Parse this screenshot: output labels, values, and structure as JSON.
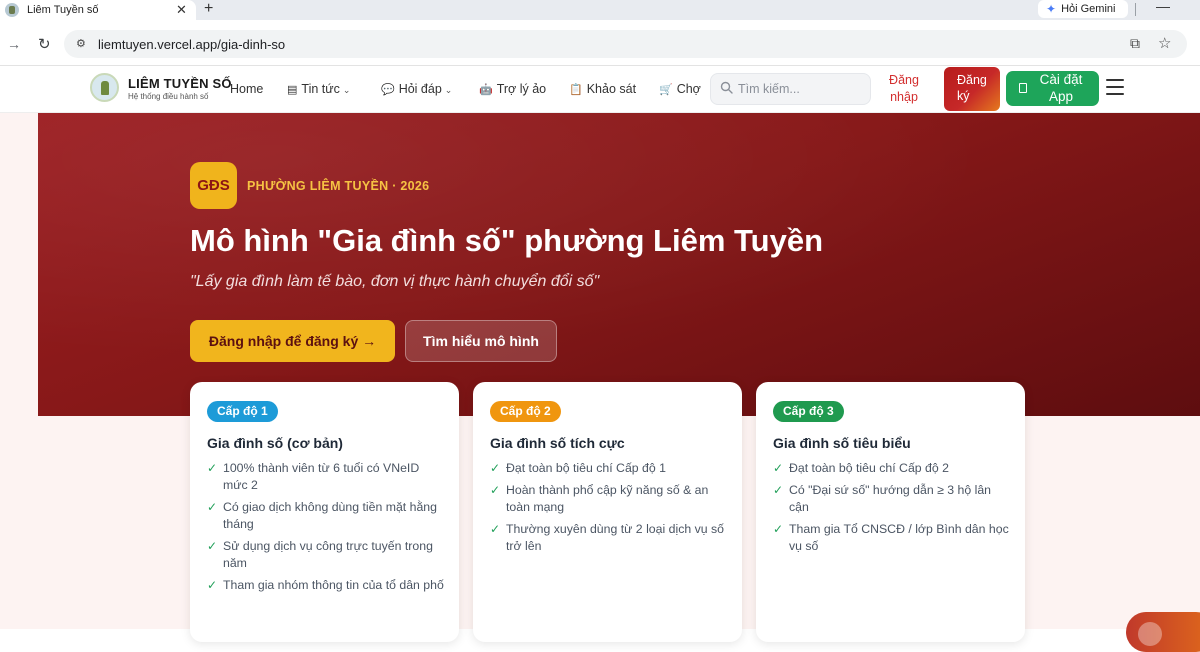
{
  "browser": {
    "tab_title": "Liêm Tuyền số",
    "tab_close": "✕",
    "new_tab": "+",
    "gemini_label": "Hỏi Gemini",
    "minimize": "—",
    "url": "liemtuyen.vercel.app/gia-dinh-so",
    "icons": [
      "back-arrow-icon",
      "reload-icon",
      "site-info-icon",
      "install-app-icon",
      "bookmark-star-icon"
    ]
  },
  "header": {
    "brand_name": "LIÊM TUYỀN SỐ",
    "brand_sub": "Hệ thống điều hành số",
    "nav": [
      {
        "label": "Home",
        "icon": "",
        "dropdown": false
      },
      {
        "label": "Tin tức",
        "icon": "▤",
        "dropdown": true
      },
      {
        "label": "Hỏi đáp",
        "icon": "💬",
        "dropdown": true
      },
      {
        "label": "Trợ lý ảo",
        "icon": "🤖",
        "dropdown": false
      },
      {
        "label": "Khảo sát",
        "icon": "📋",
        "dropdown": false
      },
      {
        "label": "Chợ",
        "icon": "🛒",
        "dropdown": false
      }
    ],
    "search_placeholder": "Tìm kiếm...",
    "login_label": "Đăng nhập",
    "register_label": "Đăng ký",
    "install_label": "Cài đặt App"
  },
  "hero": {
    "badge": "GĐS",
    "eyebrow": "PHƯỜNG LIÊM TUYỀN · 2026",
    "title": "Mô hình \"Gia đình số\" phường Liêm Tuyền",
    "quote": "\"Lấy gia đình làm tế bào, đơn vị thực hành chuyển đổi số\"",
    "cta_primary": "Đăng nhập để đăng ký →",
    "cta_secondary": "Tìm hiểu mô hình",
    "colors": {
      "accent": "#f1b51d",
      "hero_bg": "#8b1a1c"
    }
  },
  "levels": [
    {
      "pill": "Cấp độ 1",
      "color": "#1d9bd8",
      "title": "Gia đình số (cơ bản)",
      "criteria": [
        "100% thành viên từ 6 tuổi có VNeID mức 2",
        "Có giao dịch không dùng tiền mặt hằng tháng",
        "Sử dụng dịch vụ công trực tuyến trong năm",
        "Tham gia nhóm thông tin của tổ dân phố"
      ]
    },
    {
      "pill": "Cấp độ 2",
      "color": "#f0960f",
      "title": "Gia đình số tích cực",
      "criteria": [
        "Đạt toàn bộ tiêu chí Cấp độ 1",
        "Hoàn thành phổ cập kỹ năng số & an toàn mạng",
        "Thường xuyên dùng từ 2 loại dịch vụ số trở lên"
      ]
    },
    {
      "pill": "Cấp độ 3",
      "color": "#1f9a4f",
      "title": "Gia đình số tiêu biểu",
      "criteria": [
        "Đạt toàn bộ tiêu chí Cấp độ 2",
        "Có \"Đại sứ số\" hướng dẫn ≥ 3 hộ lân cận",
        "Tham gia Tổ CNSCĐ / lớp Bình dân học vụ số"
      ]
    }
  ],
  "check_mark": "✓"
}
